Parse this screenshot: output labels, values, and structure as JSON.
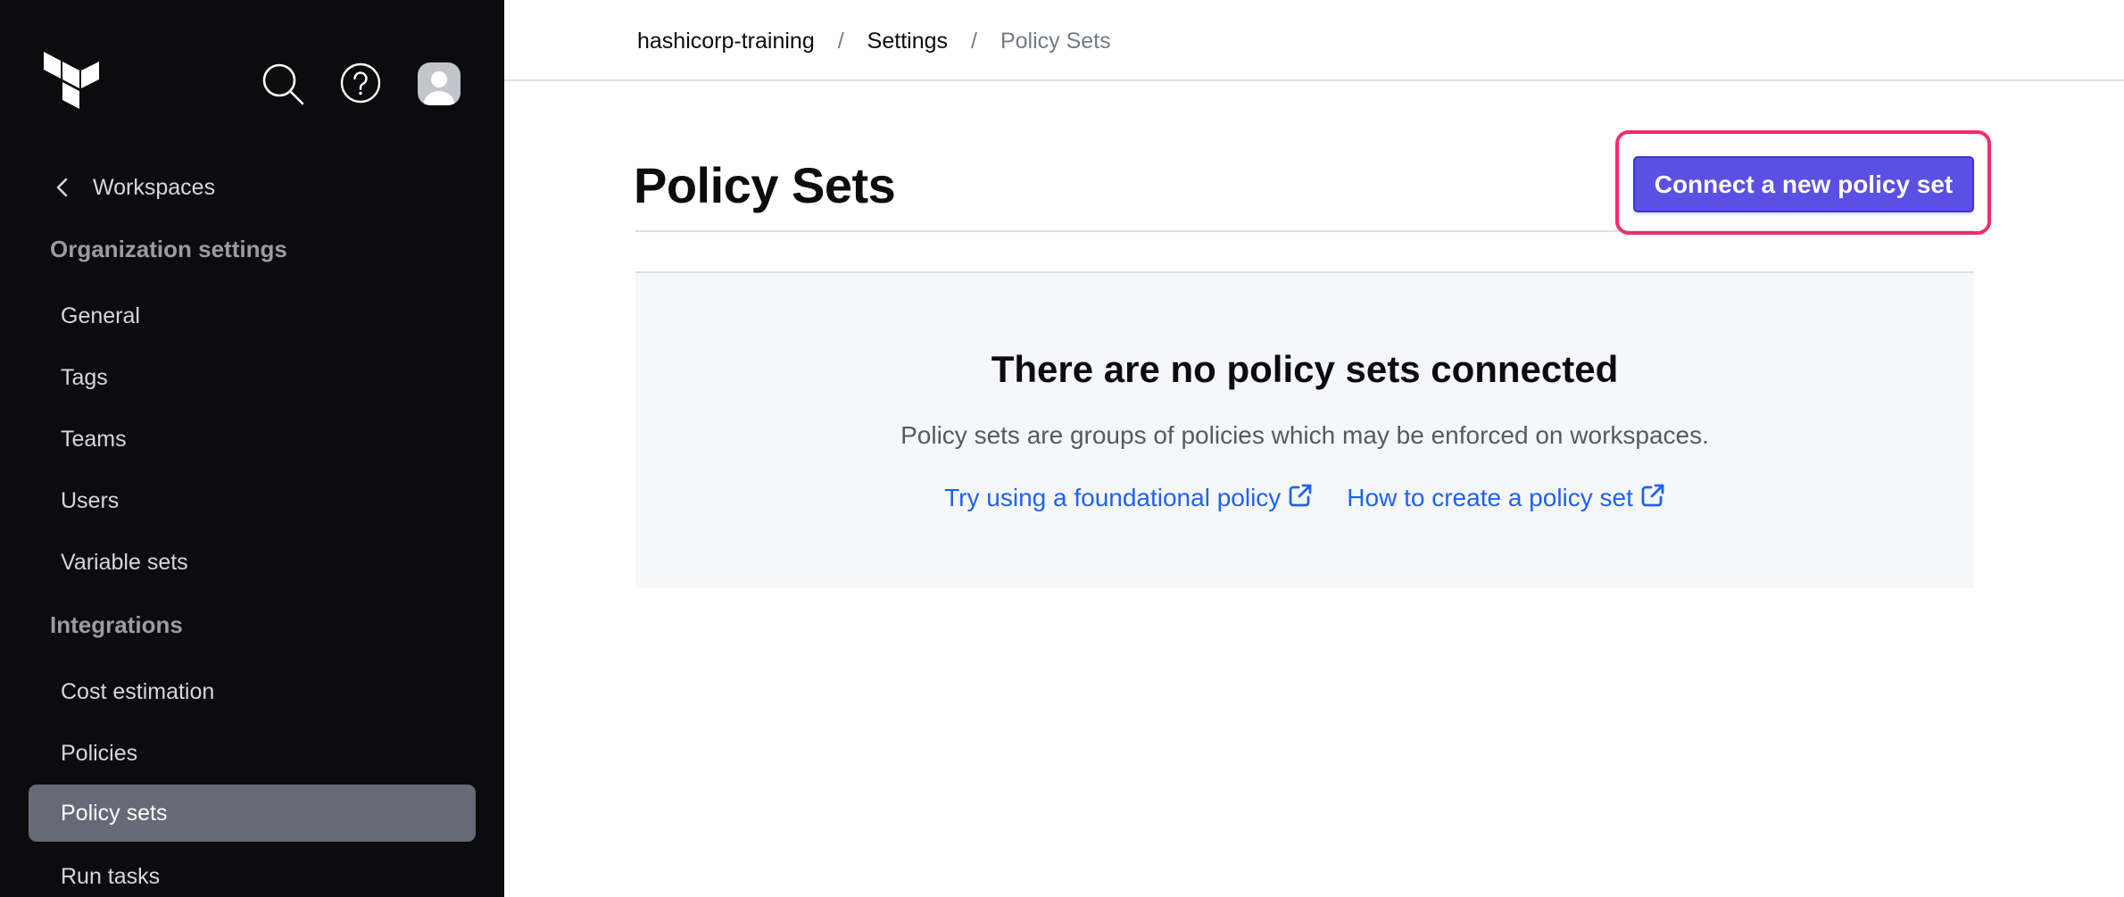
{
  "sidebar": {
    "logo": "terraform-logo",
    "top_icons": [
      "search-icon",
      "help-icon",
      "avatar-icon"
    ],
    "back_link": {
      "label": "Workspaces",
      "icon": "chevron-left-icon"
    },
    "sections": [
      {
        "header": "Organization settings",
        "items": [
          {
            "label": "General",
            "active": false
          },
          {
            "label": "Tags",
            "active": false
          },
          {
            "label": "Teams",
            "active": false
          },
          {
            "label": "Users",
            "active": false
          },
          {
            "label": "Variable sets",
            "active": false
          }
        ]
      },
      {
        "header": "Integrations",
        "items": [
          {
            "label": "Cost estimation",
            "active": false
          },
          {
            "label": "Policies",
            "active": false
          },
          {
            "label": "Policy sets",
            "active": true
          },
          {
            "label": "Run tasks",
            "active": false
          }
        ]
      }
    ]
  },
  "breadcrumb": {
    "items": [
      "hashicorp-training",
      "Settings",
      "Policy Sets"
    ],
    "separator": "/"
  },
  "page": {
    "title": "Policy Sets",
    "primary_action": "Connect a new policy set"
  },
  "empty_state": {
    "title": "There are no policy sets connected",
    "description": "Policy sets are groups of policies which may be enforced on workspaces.",
    "links": [
      {
        "label": "Try using a foundational policy",
        "icon": "external-link-icon"
      },
      {
        "label": "How to create a policy set",
        "icon": "external-link-icon"
      }
    ]
  },
  "colors": {
    "sidebar_bg": "#0c0c0e",
    "sidebar_active_bg": "#656a76",
    "primary_button": "#5b4fe4",
    "highlight": "#f72a6b",
    "link": "#1f62f0",
    "empty_state_bg": "#f6f7f9"
  }
}
